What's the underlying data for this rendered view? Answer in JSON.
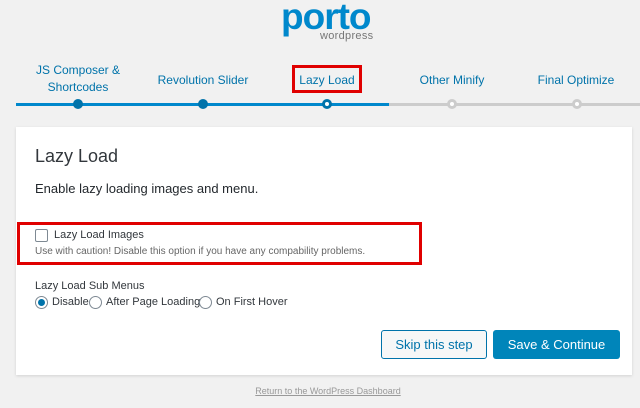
{
  "brand": {
    "name": "porto",
    "subtitle": "wordpress",
    "color": "#0088cc"
  },
  "steps": [
    {
      "label": "JS Composer & Shortcodes",
      "state": "done"
    },
    {
      "label": "Revolution Slider",
      "state": "done"
    },
    {
      "label": "Lazy Load",
      "state": "current"
    },
    {
      "label": "Other Minify",
      "state": "todo"
    },
    {
      "label": "Final Optimize",
      "state": "todo"
    }
  ],
  "card": {
    "title": "Lazy Load",
    "description": "Enable lazy loading images and menu.",
    "lazy_images": {
      "label": "Lazy Load Images",
      "checked": false,
      "help": "Use with caution! Disable this option if you have any compability problems."
    },
    "sub_menus": {
      "title": "Lazy Load Sub Menus",
      "options": [
        "Disable",
        "After Page Loading",
        "On First Hover"
      ],
      "selected": "Disable"
    }
  },
  "buttons": {
    "skip": "Skip this step",
    "continue": "Save & Continue"
  },
  "footer": {
    "link": "Return to the WordPress Dashboard"
  },
  "colors": {
    "accent": "#0073aa",
    "highlight": "#e00000",
    "inactive": "#cccccc"
  }
}
